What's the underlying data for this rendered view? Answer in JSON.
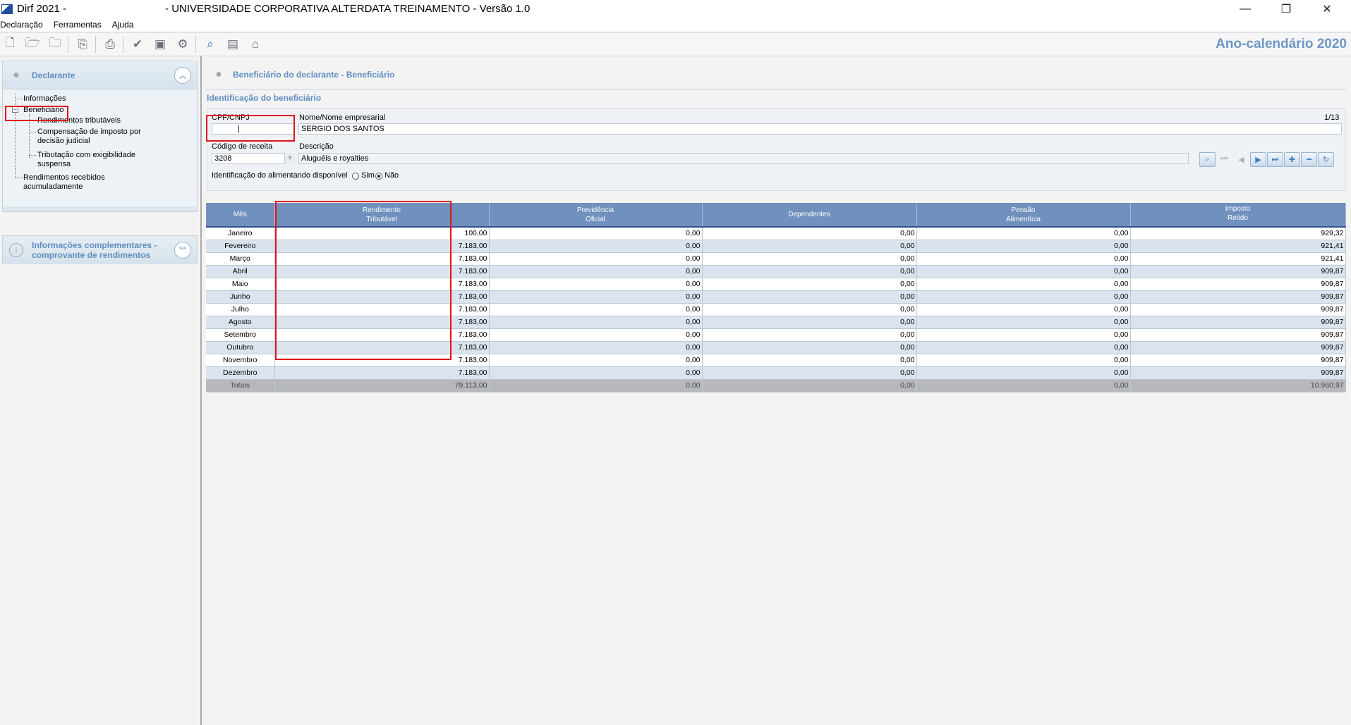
{
  "window": {
    "app_name": "Dirf 2021 -",
    "subtitle": "- UNIVERSIDADE CORPORATIVA ALTERDATA TREINAMENTO - Versão 1.0",
    "minimize": "—",
    "restore": "❐",
    "close": "✕"
  },
  "menu": [
    "Declaração",
    "Ferramentas",
    "Ajuda"
  ],
  "toolbar": {
    "year_label": "Ano-calendário 2020",
    "icons": [
      "new-file-icon",
      "open-folder-icon",
      "folder-icon",
      "copy-icon",
      "print-icon",
      "check-icon",
      "save-icon",
      "gear-icon",
      "search-icon",
      "calculator-icon",
      "transmit-icon"
    ]
  },
  "sidebar": {
    "declarante_title": "Declarante",
    "tree": {
      "informacoes": "Informações",
      "beneficiario": "Beneficiário",
      "rendimentos_tributaveis": "Rendimentos tributáveis",
      "compensacao_1": "Compensação de imposto por",
      "compensacao_2": "decisão judicial",
      "tributacao_1": "Tributação com exigibilidade",
      "tributacao_2": "suspensa",
      "rra_1": "Rendimentos recebidos",
      "rra_2": "acumuladamente"
    },
    "complementares_1": "Informações complementares -",
    "complementares_2": "comprovante de rendimentos"
  },
  "main": {
    "page_title": "Beneficiário do declarante - Beneficiário",
    "section_title": "Identificação do beneficiário",
    "cpf_label": "CPF/CNPJ",
    "cpf_value": "|",
    "nome_label": "Nome/Nome empresarial",
    "nome_value": "SERGIO DOS SANTOS",
    "counter": "1/13",
    "codigo_label": "Código de receita",
    "codigo_value": "3208",
    "descricao_label": "Descrição",
    "descricao_value": "Aluguéis e royalties",
    "alimentando_label": "Identificação do alimentando disponível",
    "sim": "Sim",
    "nao": "Não",
    "alimentando_selected": "Não"
  },
  "table": {
    "headers": [
      [
        "Mês",
        ""
      ],
      [
        "Rendimento",
        "Tributável"
      ],
      [
        "Previdência",
        "Oficial"
      ],
      [
        "Dependentes",
        ""
      ],
      [
        "Pensão",
        "Alimentícia"
      ],
      [
        "Imposto",
        "Retido"
      ]
    ],
    "rows": [
      [
        "Janeiro",
        "100,00",
        "0,00",
        "0,00",
        "0,00",
        "929,32"
      ],
      [
        "Fevereiro",
        "7.183,00",
        "0,00",
        "0,00",
        "0,00",
        "921,41"
      ],
      [
        "Março",
        "7.183,00",
        "0,00",
        "0,00",
        "0,00",
        "921,41"
      ],
      [
        "Abril",
        "7.183,00",
        "0,00",
        "0,00",
        "0,00",
        "909,87"
      ],
      [
        "Maio",
        "7.183,00",
        "0,00",
        "0,00",
        "0,00",
        "909,87"
      ],
      [
        "Junho",
        "7.183,00",
        "0,00",
        "0,00",
        "0,00",
        "909,87"
      ],
      [
        "Julho",
        "7.183,00",
        "0,00",
        "0,00",
        "0,00",
        "909,87"
      ],
      [
        "Agosto",
        "7.183,00",
        "0,00",
        "0,00",
        "0,00",
        "909,87"
      ],
      [
        "Setembro",
        "7.183,00",
        "0,00",
        "0,00",
        "0,00",
        "909,87"
      ],
      [
        "Outubro",
        "7.183,00",
        "0,00",
        "0,00",
        "0,00",
        "909,87"
      ],
      [
        "Novembro",
        "7.183,00",
        "0,00",
        "0,00",
        "0,00",
        "909,87"
      ],
      [
        "Dezembro",
        "7.183,00",
        "0,00",
        "0,00",
        "0,00",
        "909,87"
      ]
    ],
    "totals": [
      "Totais",
      "79.113,00",
      "0,00",
      "0,00",
      "0,00",
      "10.960,97"
    ]
  },
  "colors": {
    "accent_blue": "#5f8ec0",
    "table_header": "#7090be",
    "highlight_red": "#e0141b"
  }
}
